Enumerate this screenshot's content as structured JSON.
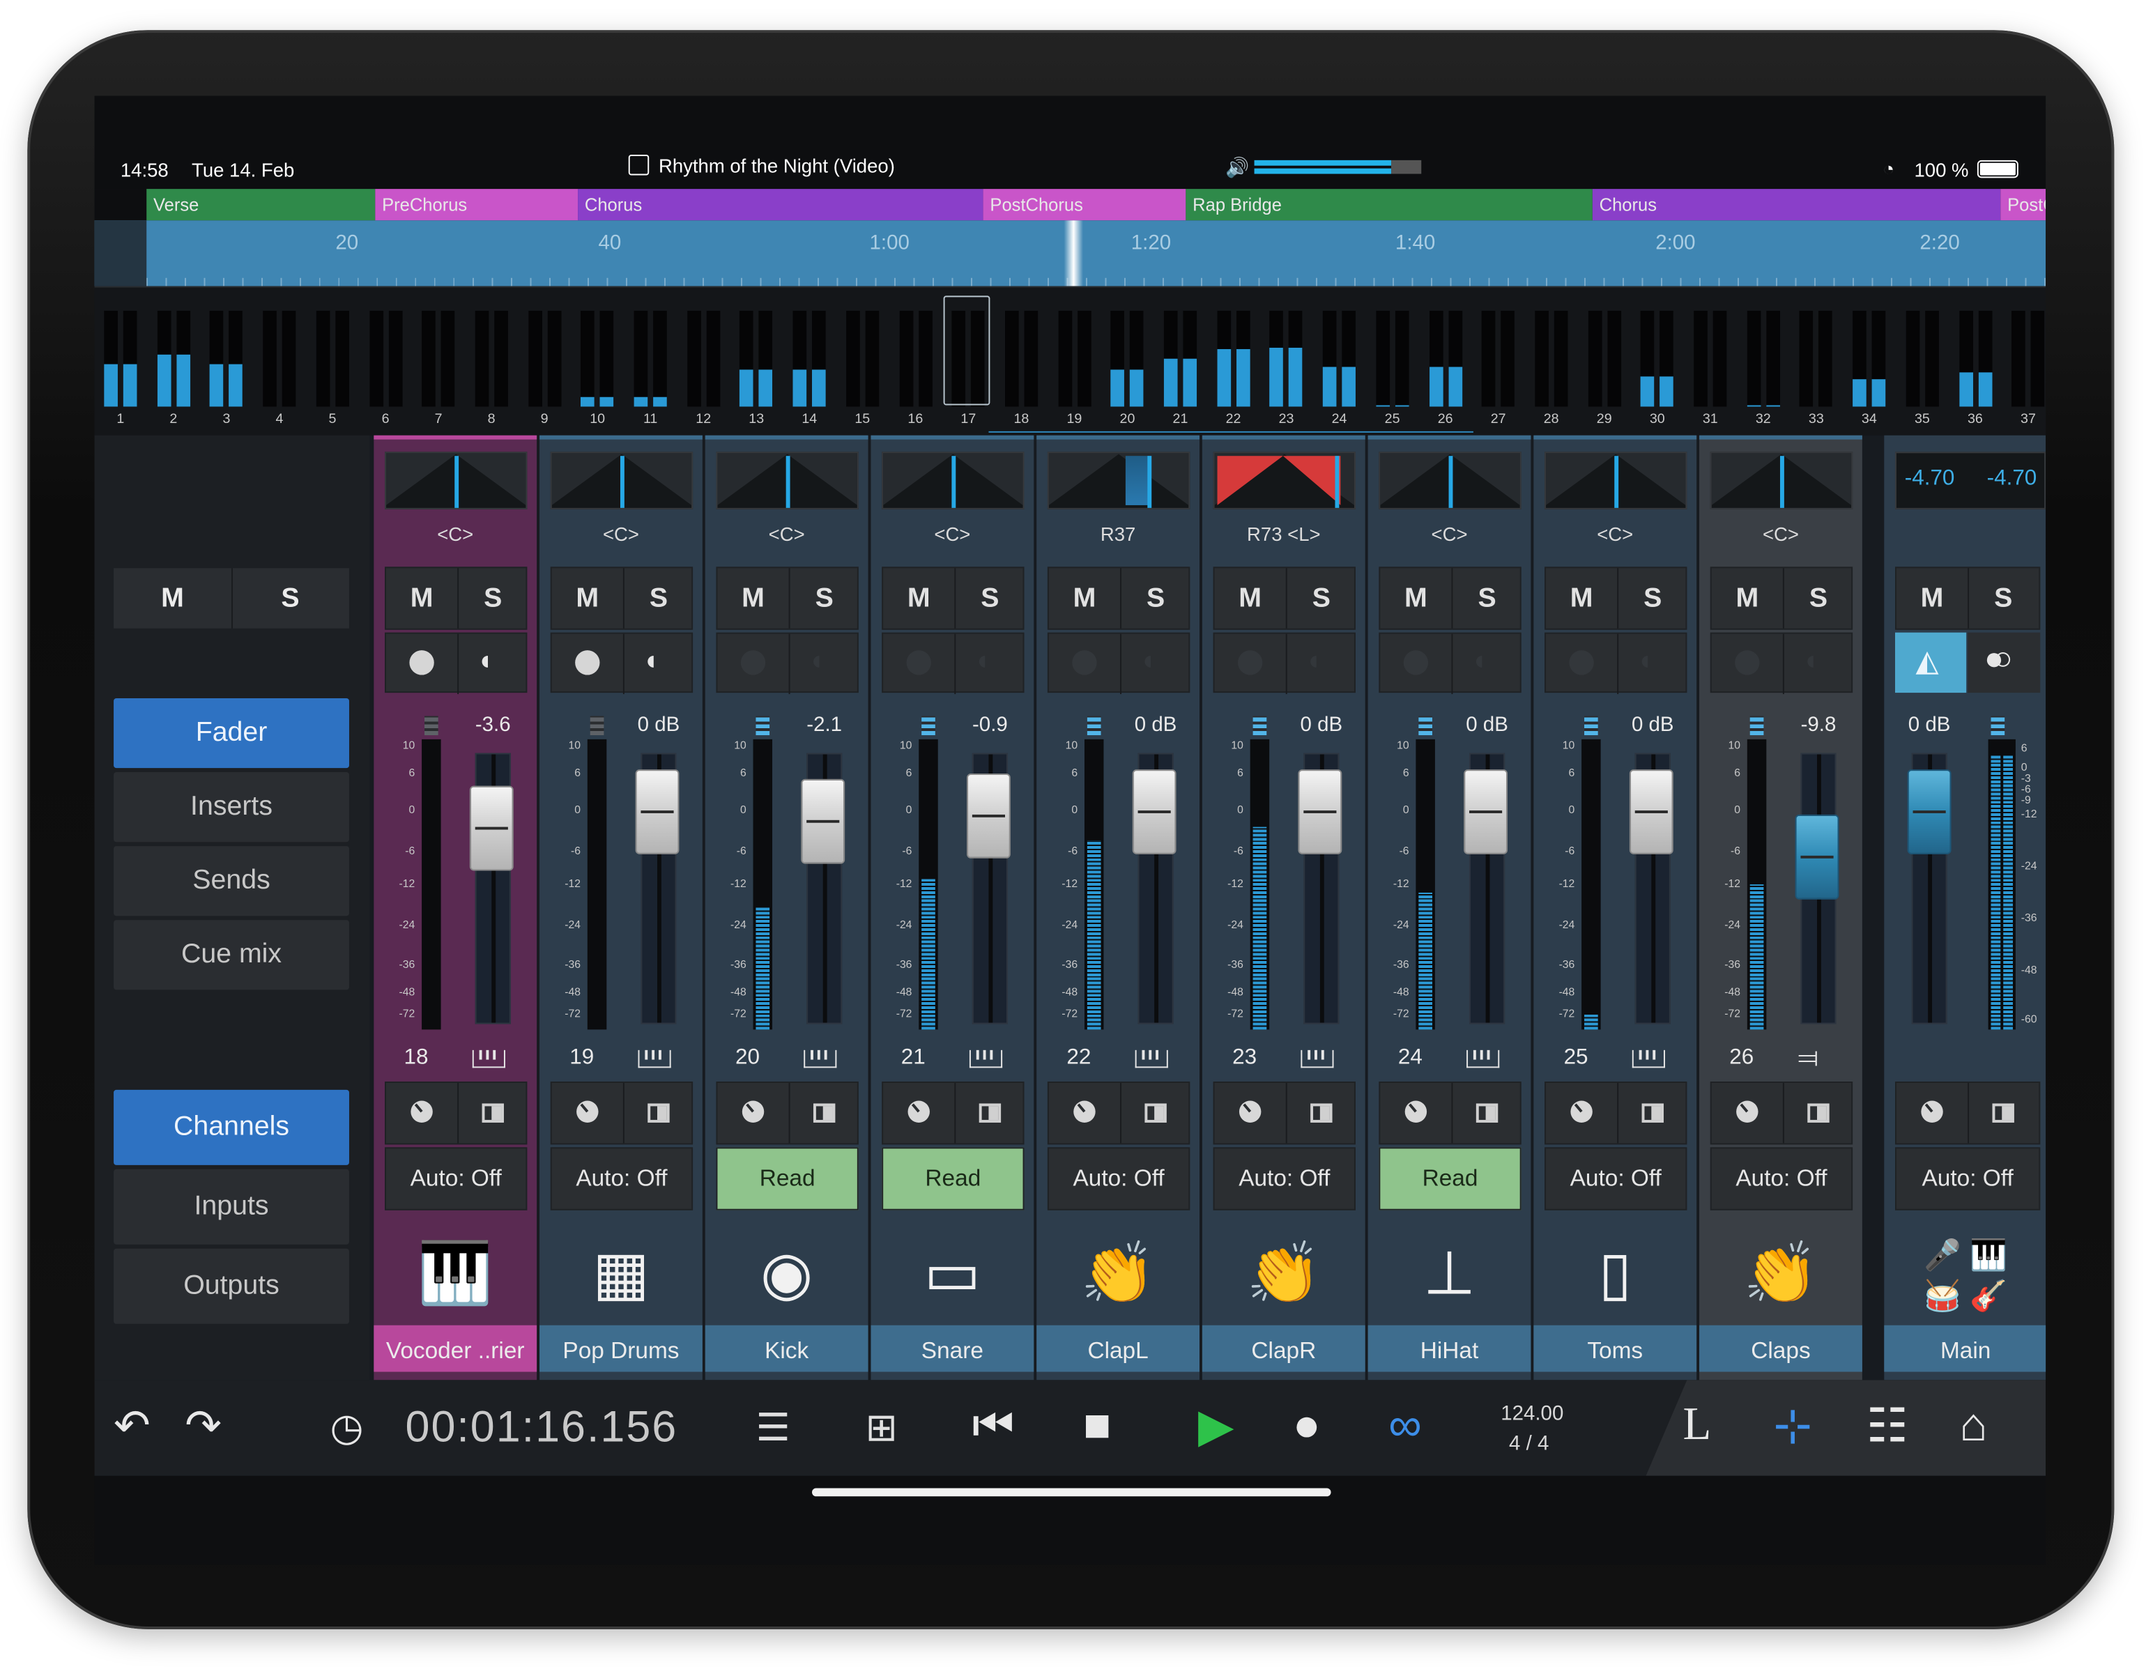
{
  "status_bar": {
    "time": "14:58",
    "date": "Tue 14. Feb",
    "project_title": "Rhythm of the Night (Video)",
    "battery": "100 %",
    "volume_level": 0.82
  },
  "arranger": {
    "sections": [
      {
        "label": "Verse",
        "color": "#2f8a4a"
      },
      {
        "label": "PreChorus",
        "color": "#c955c9"
      },
      {
        "label": "Chorus",
        "color": "#8a3fc9"
      },
      {
        "label": "PostChorus",
        "color": "#c955c9"
      },
      {
        "label": "Rap Bridge",
        "color": "#2f8a4a"
      },
      {
        "label": "Chorus",
        "color": "#8a3fc9"
      },
      {
        "label": "PostChorus",
        "color": "#c955c9"
      }
    ],
    "ruler_ticks": [
      "20",
      "40",
      "1:00",
      "1:20",
      "1:40",
      "2:00",
      "2:20"
    ]
  },
  "overview": {
    "channels": [
      "1",
      "2",
      "3",
      "4",
      "5",
      "6",
      "7",
      "8",
      "9",
      "10",
      "11",
      "12",
      "13",
      "14",
      "15",
      "16",
      "17",
      "18",
      "19",
      "20",
      "21",
      "22",
      "23",
      "24",
      "25",
      "26",
      "27",
      "28",
      "29",
      "30",
      "31",
      "32",
      "33",
      "34",
      "35",
      "36",
      "37"
    ],
    "levels": [
      0.45,
      0.55,
      0.45,
      0,
      0,
      0,
      0,
      0,
      0,
      0.1,
      0.1,
      0,
      0.38,
      0.38,
      0,
      0,
      0,
      0,
      0,
      0.38,
      0.5,
      0.6,
      0.62,
      0.42,
      0.02,
      0.42,
      0,
      0,
      0,
      0.32,
      0,
      0.02,
      0,
      0.28,
      0,
      0.36,
      0
    ]
  },
  "left_panel": {
    "mute_label": "M",
    "solo_label": "S",
    "view_buttons": [
      "Fader",
      "Inserts",
      "Sends",
      "Cue mix"
    ],
    "source_buttons": [
      "Channels",
      "Inputs",
      "Outputs"
    ]
  },
  "channels": [
    {
      "name": "Vocoder ..rier",
      "number": "18",
      "pan": "<C>",
      "volume": "-3.6",
      "automation": "Auto: Off",
      "meter_level": 0,
      "fader_gain_db": -3.6,
      "icon": "piano-icon",
      "color": "#b8489c"
    },
    {
      "name": "Pop Drums",
      "number": "19",
      "pan": "<C>",
      "volume": "0 dB",
      "automation": "Auto: Off",
      "meter_level": 0,
      "fader_gain_db": 0,
      "icon": "drum-machine-icon",
      "color": "#3e6d8e"
    },
    {
      "name": "Kick",
      "number": "20",
      "pan": "<C>",
      "volume": "-2.1",
      "automation": "Read",
      "meter_level": 0.42,
      "fader_gain_db": -2.1,
      "icon": "kick-drum-icon",
      "color": "#3e6d8e"
    },
    {
      "name": "Snare",
      "number": "21",
      "pan": "<C>",
      "volume": "-0.9",
      "automation": "Read",
      "meter_level": 0.52,
      "fader_gain_db": -0.9,
      "icon": "snare-icon",
      "color": "#3e6d8e"
    },
    {
      "name": "ClapL",
      "number": "22",
      "pan": "R37",
      "volume": "0 dB",
      "automation": "Auto: Off",
      "meter_level": 0.65,
      "fader_gain_db": 0,
      "icon": "clap-icon",
      "color": "#3e6d8e"
    },
    {
      "name": "ClapR",
      "number": "23",
      "pan": "R73 <L>",
      "volume": "0 dB",
      "automation": "Auto: Off",
      "meter_level": 0.7,
      "fader_gain_db": 0,
      "icon": "clap-icon",
      "color": "#3e6d8e"
    },
    {
      "name": "HiHat",
      "number": "24",
      "pan": "<C>",
      "volume": "0 dB",
      "automation": "Read",
      "meter_level": 0.47,
      "fader_gain_db": 0,
      "icon": "cymbal-icon",
      "color": "#3e6d8e"
    },
    {
      "name": "Toms",
      "number": "25",
      "pan": "<C>",
      "volume": "0 dB",
      "automation": "Auto: Off",
      "meter_level": 0.05,
      "fader_gain_db": 0,
      "icon": "tom-icon",
      "color": "#3e6d8e"
    },
    {
      "name": "Claps",
      "number": "26",
      "pan": "<C>",
      "volume": "-9.8",
      "automation": "Auto: Off",
      "meter_level": 0.5,
      "fader_gain_db": -9.8,
      "icon": "clap-icon",
      "color": "#3e6d8e"
    }
  ],
  "main_channel": {
    "name": "Main",
    "volume": "0 dB",
    "peak_left": "-4.70",
    "peak_right": "-4.70",
    "automation": "Auto: Off",
    "meter_level": 0.95,
    "scale": [
      "6",
      "0",
      "-3",
      "-6",
      "-9",
      "-12",
      "-24",
      "-36",
      "-48",
      "-60"
    ]
  },
  "fader_scale": [
    "10",
    "6",
    "0",
    "-6",
    "-12",
    "-24",
    "-36",
    "-48",
    "-72"
  ],
  "transport": {
    "timecode": "00:01:16.156",
    "tempo": "124.00",
    "signature_num": "4",
    "signature_sep": "/",
    "signature_den": "4",
    "left_label": "L"
  },
  "colors": {
    "accent_blue": "#2e72c2",
    "meter_blue": "#2a9ad6",
    "read_green": "#8fc48c",
    "play_green": "#2ec24a",
    "loop_blue": "#3d8ee8"
  }
}
